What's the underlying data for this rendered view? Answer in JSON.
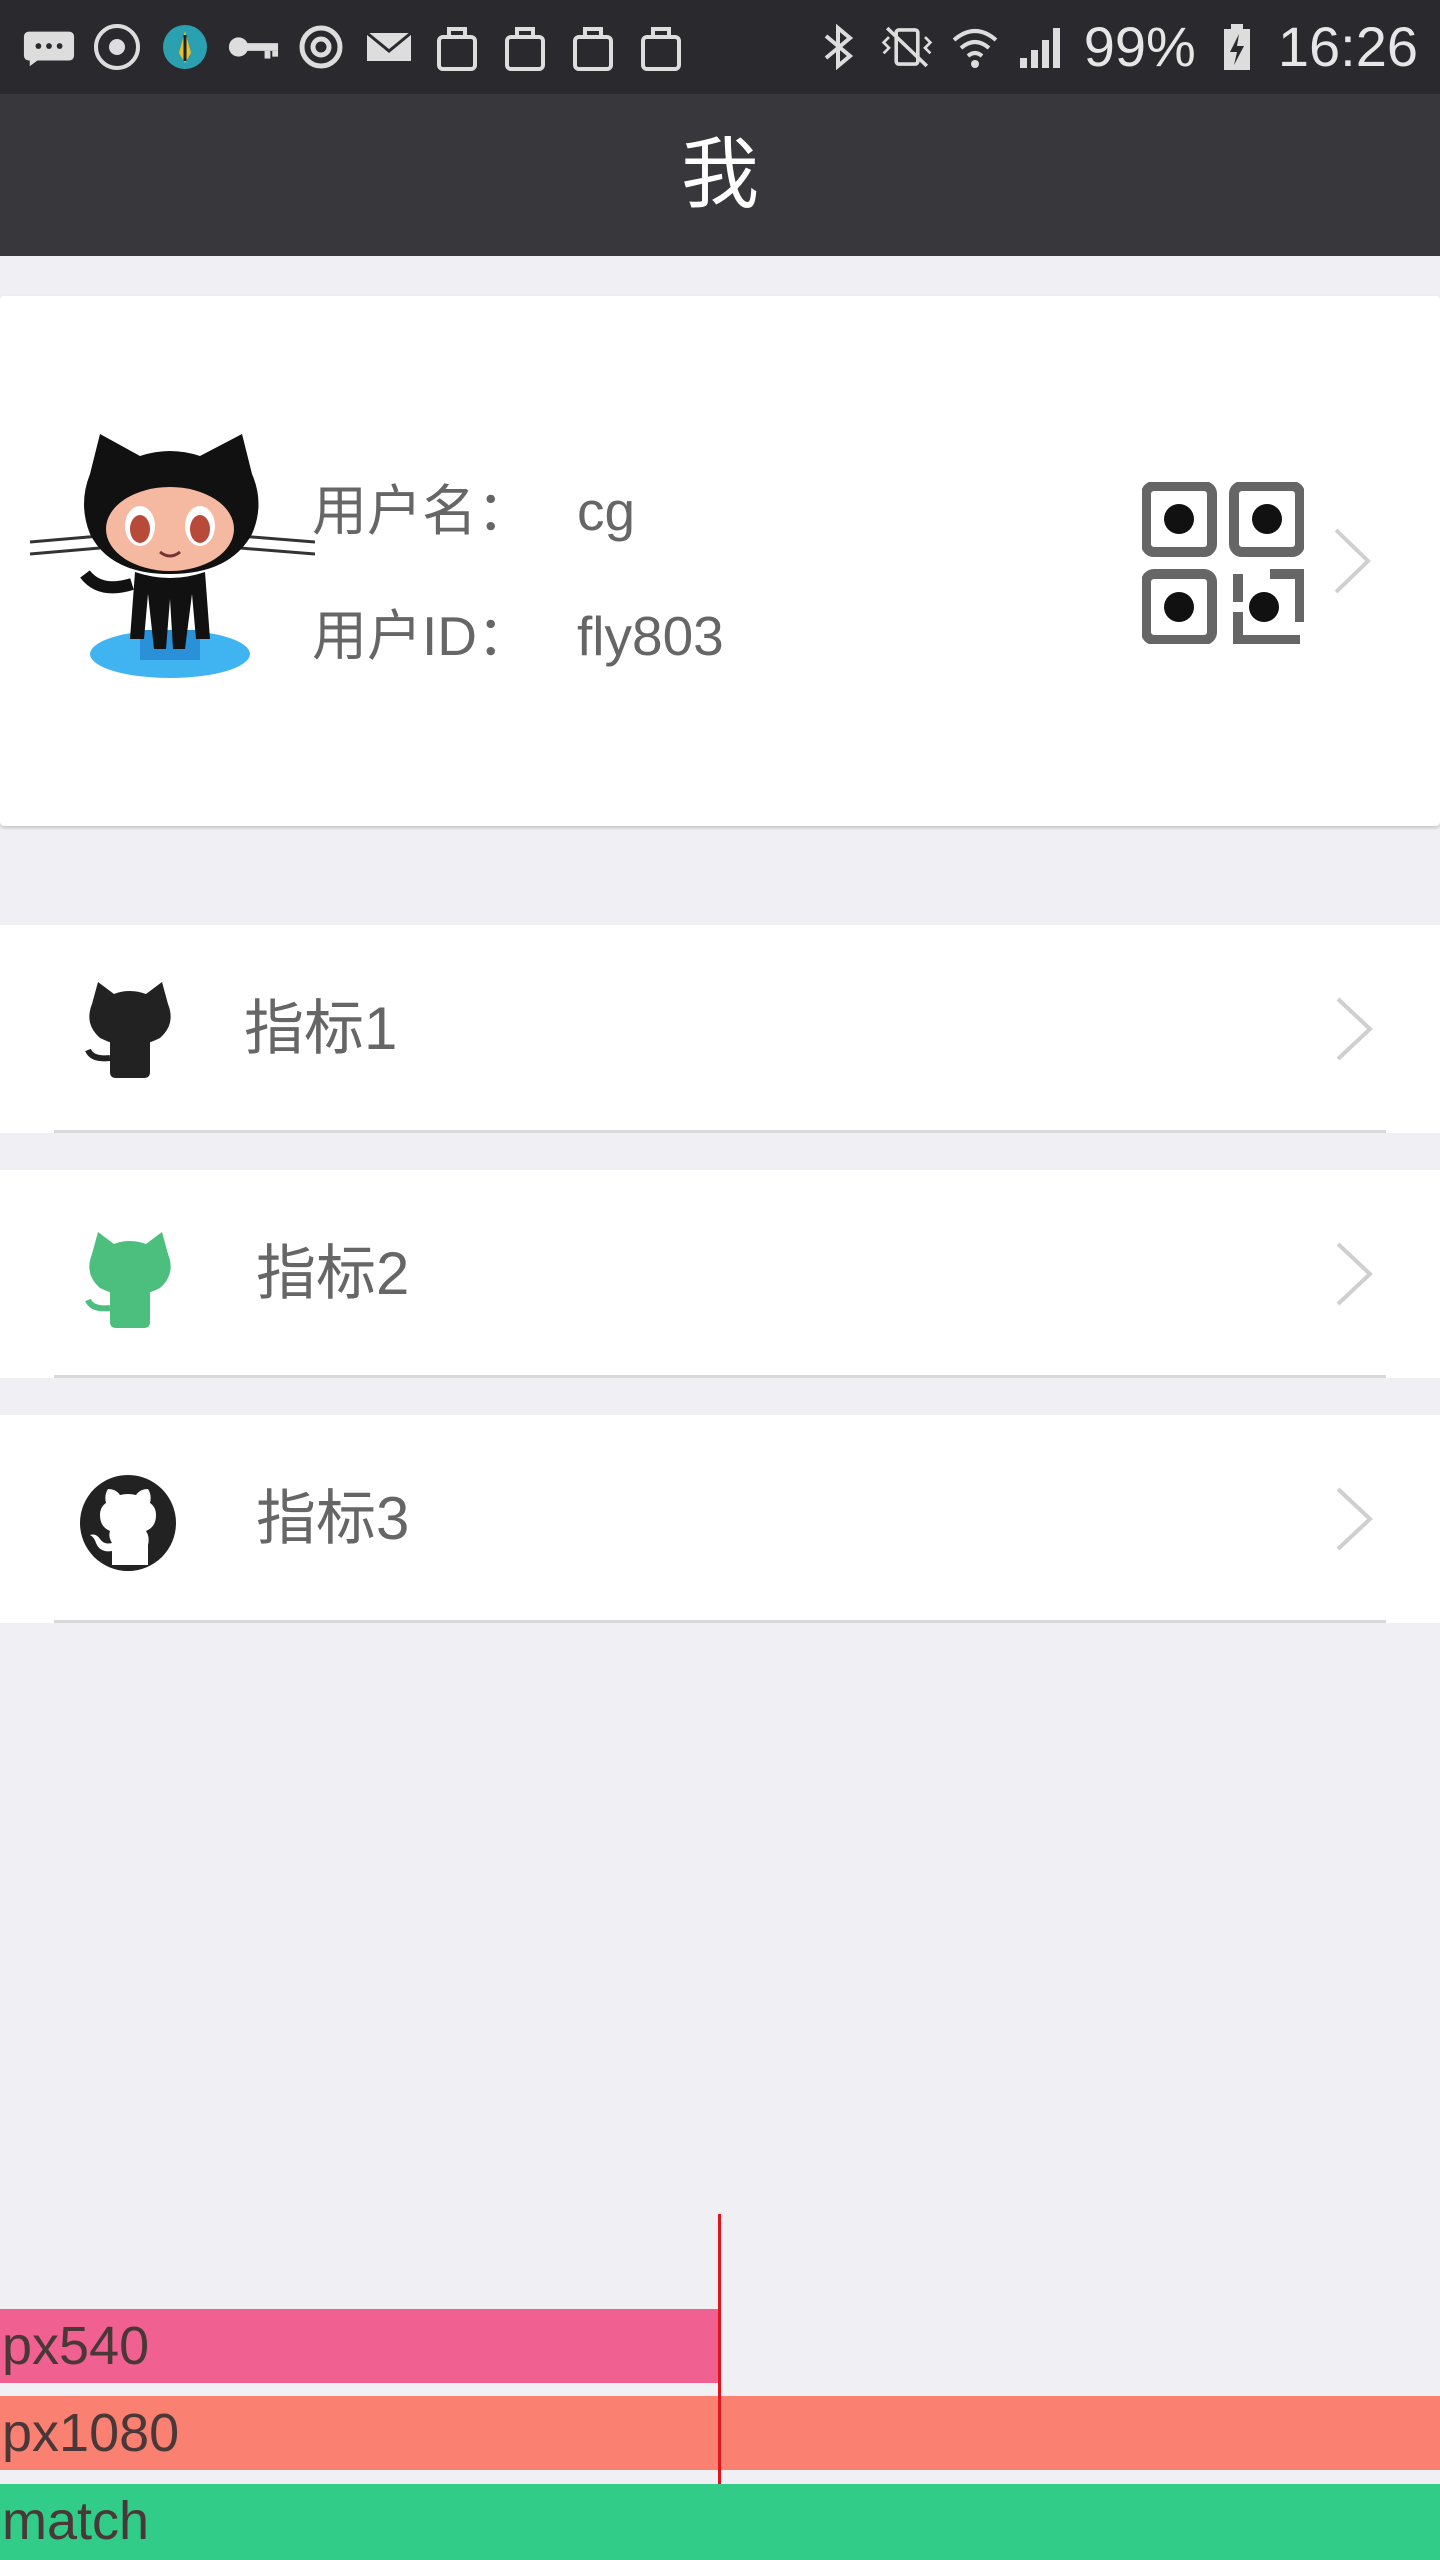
{
  "status_bar": {
    "battery_percent": "99%",
    "time": "16:26",
    "left_icons": [
      "message-icon",
      "spinner-app-icon",
      "feather-app-icon",
      "key-icon",
      "sync-icon",
      "mail-icon",
      "bag-icon",
      "bag-icon",
      "bag-icon",
      "bag-icon"
    ],
    "right_icons": [
      "bluetooth-icon",
      "vibrate-icon",
      "wifi-icon",
      "signal-icon",
      "battery-charging-icon"
    ]
  },
  "header": {
    "title": "我"
  },
  "profile": {
    "username_label": "用户名：",
    "username": "cg",
    "userid_label": "用户ID：",
    "userid": "fly803",
    "avatar_icon": "octocat-avatar-icon",
    "qr_icon": "qr-code-icon"
  },
  "menu": [
    {
      "label": "指标1",
      "icon": "octocat-black-icon",
      "color": "#222222"
    },
    {
      "label": "指标2",
      "icon": "octocat-green-icon",
      "color": "#4cbf7f"
    },
    {
      "label": "指标3",
      "icon": "github-circle-icon",
      "color": "#222222"
    }
  ],
  "debug_bars": {
    "px540": "px540",
    "px1080": "px1080",
    "match": "match",
    "colors": {
      "px540": "#f06090",
      "px1080": "#fa8072",
      "match": "#31cc88",
      "guide": "#e0141e"
    }
  }
}
